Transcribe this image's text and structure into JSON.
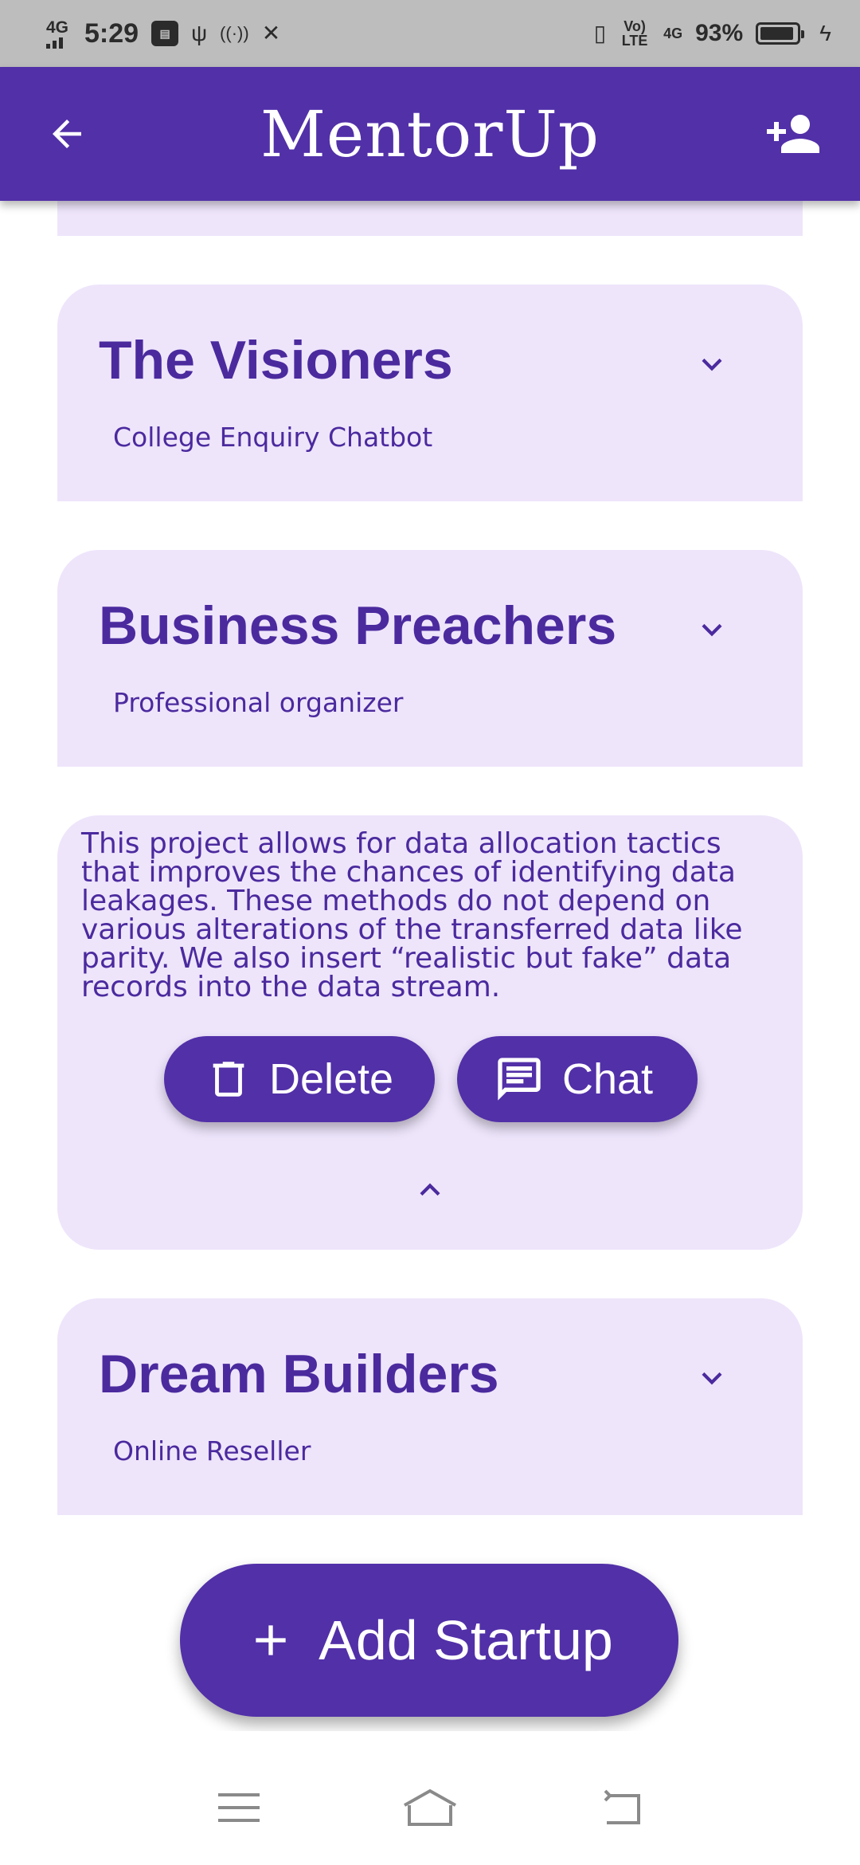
{
  "status_bar": {
    "network_small": "4G",
    "time": "5:29",
    "volte": "Vo) LTE",
    "network_4g": "4G",
    "battery_percent": "93%",
    "battery_level": 0.93,
    "icons": [
      "signal-icon",
      "notification-badge-icon",
      "usb-icon",
      "hotspot-icon",
      "tools-icon",
      "vibrate-icon",
      "charging-icon"
    ]
  },
  "app_bar": {
    "title": "MentorUp",
    "back_icon": "arrow-left-icon",
    "add_person_icon": "person-add-icon"
  },
  "startups": [
    {
      "name": "The Visioners",
      "project": "College Enquiry Chatbot",
      "expanded": false
    },
    {
      "name": "Business Preachers",
      "project": "Professional organizer",
      "expanded": false
    },
    {
      "name": "",
      "project": "",
      "expanded": true,
      "description": "This project allows for data allocation tactics that improves the chances of identifying data leakages. These methods do not depend on various alterations of the transferred data like parity. We also insert “realistic but fake” data records into the data stream.",
      "delete_label": "Delete",
      "chat_label": "Chat"
    },
    {
      "name": "Dream Builders",
      "project": "Online Reseller",
      "expanded": false
    }
  ],
  "add_button": {
    "label": "Add Startup"
  },
  "colors": {
    "primary": "#5230a8",
    "card_bg": "#eee5fb",
    "text_primary": "#4b2a9e",
    "status_bar_bg": "#bdbdbd"
  },
  "nav_bar": {
    "icons": [
      "menu-icon",
      "home-icon",
      "back-icon"
    ]
  }
}
